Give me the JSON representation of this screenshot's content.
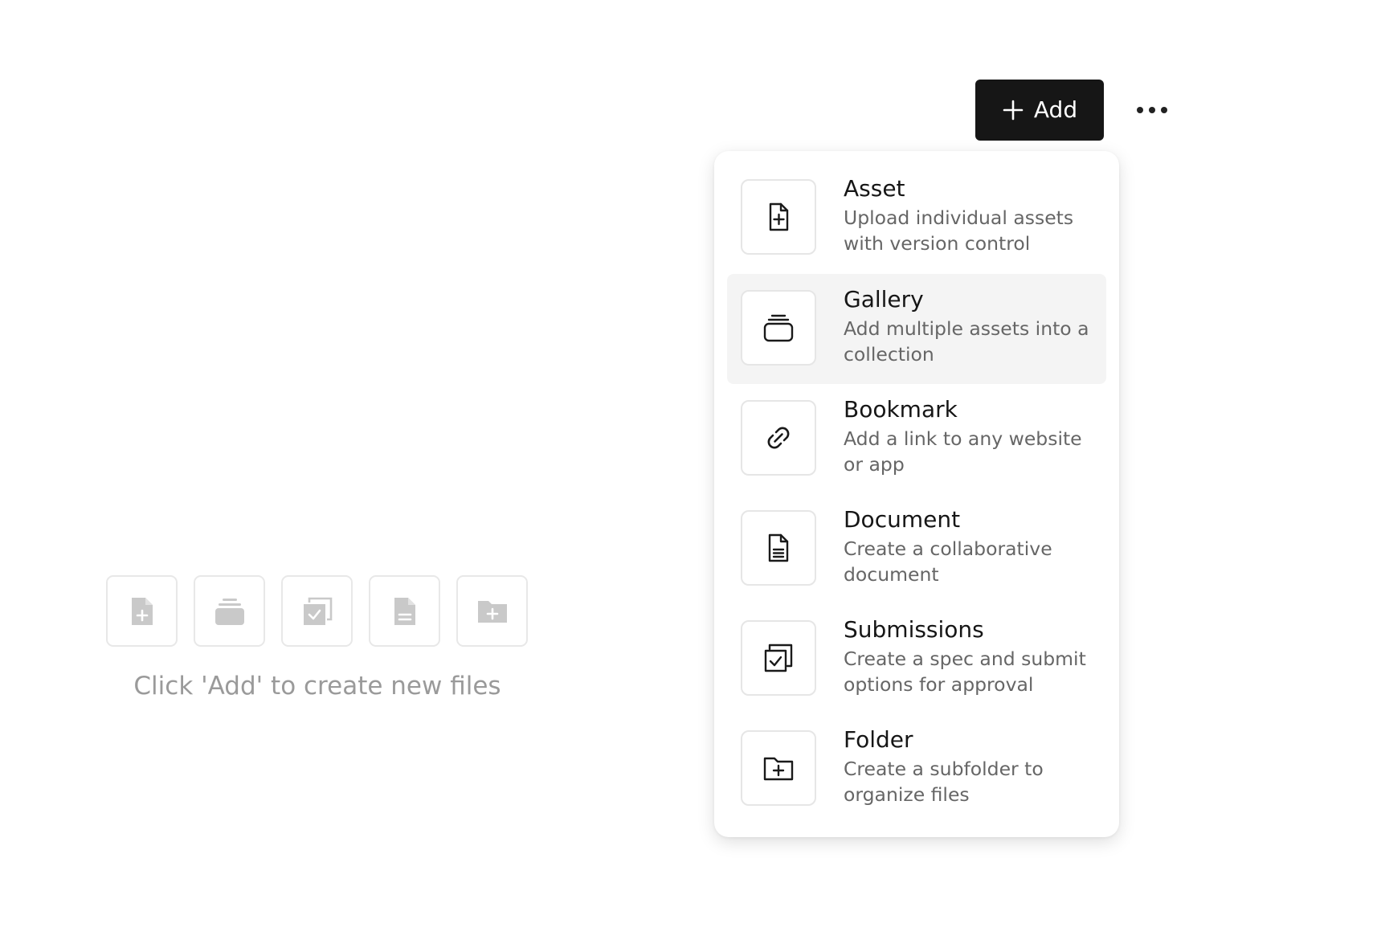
{
  "toolbar": {
    "add_label": "Add",
    "more_icon": "ellipsis-icon"
  },
  "menu": {
    "items": [
      {
        "title": "Asset",
        "description": "Upload individual assets with version control",
        "icon": "file-plus-icon",
        "highlighted": false
      },
      {
        "title": "Gallery",
        "description": "Add multiple assets into a collection",
        "icon": "stack-icon",
        "highlighted": true
      },
      {
        "title": "Bookmark",
        "description": "Add a link to any website or app",
        "icon": "link-icon",
        "highlighted": false
      },
      {
        "title": "Document",
        "description": "Create a collaborative document",
        "icon": "document-icon",
        "highlighted": false
      },
      {
        "title": "Submissions",
        "description": "Create a spec and submit options for approval",
        "icon": "submissions-icon",
        "highlighted": false
      },
      {
        "title": "Folder",
        "description": "Create a subfolder to organize files",
        "icon": "folder-plus-icon",
        "highlighted": false
      }
    ]
  },
  "empty_state": {
    "icons": [
      "file-plus-icon",
      "stack-icon",
      "submissions-icon",
      "document-icon",
      "folder-plus-icon"
    ],
    "message": "Click 'Add' to create new files"
  },
  "colors": {
    "primary_button": "#161616",
    "highlight": "#f4f4f4",
    "muted_text": "#9a9a9a",
    "description_text": "#666666"
  }
}
